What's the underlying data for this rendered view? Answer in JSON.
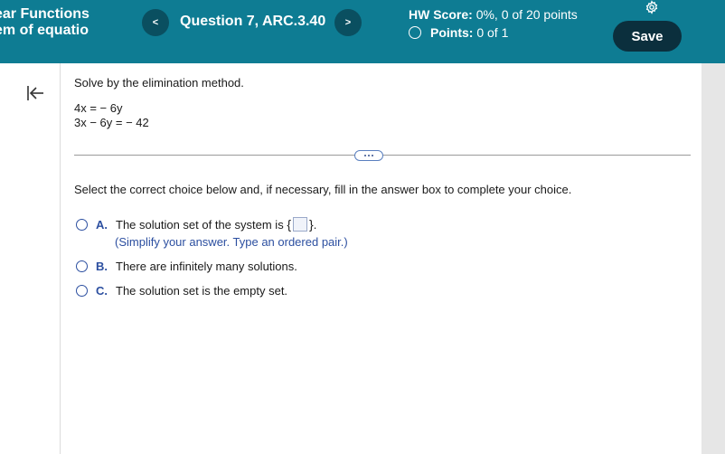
{
  "header": {
    "title_line1": "ear Functions",
    "title_line2": "em of equatio",
    "prev_symbol": "<",
    "next_symbol": ">",
    "question_label": "Question 7, ARC.3.40",
    "hw_score_label": "HW Score:",
    "hw_score_value": "0%, 0 of 20 points",
    "points_label": "Points:",
    "points_value": "0 of 1",
    "save_label": "Save"
  },
  "problem": {
    "instruction": "Solve by the elimination method.",
    "equation1": "4x = − 6y",
    "equation2": "3x − 6y = − 42",
    "more_label": "..."
  },
  "answer": {
    "prompt": "Select the correct choice below and, if necessary, fill in the answer box to complete your choice.",
    "choices": [
      {
        "letter": "A.",
        "text": "The solution set of the system is",
        "hint": "(Simplify your answer. Type an ordered pair.)"
      },
      {
        "letter": "B.",
        "text": "There are infinitely many solutions."
      },
      {
        "letter": "C.",
        "text": "The solution set is the empty set."
      }
    ]
  },
  "colors": {
    "header_bg": "#0e7c93",
    "save_bg": "#0b2f3d",
    "accent_blue": "#2c4fa0"
  },
  "icons": {
    "settings": "gear-icon",
    "collapse": "collapse-left-icon"
  }
}
